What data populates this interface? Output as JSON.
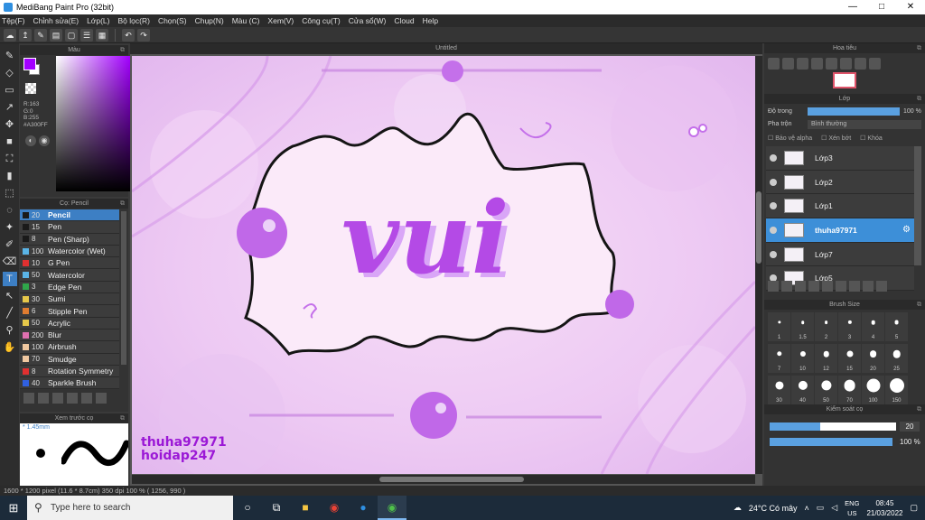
{
  "window": {
    "title": "MediBang Paint Pro (32bit)",
    "min": "—",
    "max": "□",
    "close": "✕"
  },
  "menu": [
    "Tệp(F)",
    "Chỉnh sửa(E)",
    "Lớp(L)",
    "Bộ lọc(R)",
    "Chọn(S)",
    "Chụp(N)",
    "Màu (C)",
    "Xem(V)",
    "Công cụ(T)",
    "Cửa sổ(W)",
    "Cloud",
    "Help"
  ],
  "color_panel": {
    "title": "Màu",
    "r": "R:163",
    "g": "G:0",
    "b": "B:255",
    "hex": "#A300FF",
    "fg_color": "#A300FF"
  },
  "brush_panel": {
    "title": "Cọ: Pencil",
    "brushes": [
      {
        "size": "20",
        "name": "Pencil",
        "color": "#1a1a1a"
      },
      {
        "size": "15",
        "name": "Pen",
        "color": "#1a1a1a"
      },
      {
        "size": "8",
        "name": "Pen (Sharp)",
        "color": "#1a1a1a"
      },
      {
        "size": "100",
        "name": "Watercolor (Wet)",
        "color": "#5ab4e6"
      },
      {
        "size": "10",
        "name": "G Pen",
        "color": "#e03030"
      },
      {
        "size": "50",
        "name": "Watercolor",
        "color": "#5ab4e6"
      },
      {
        "size": "3",
        "name": "Edge Pen",
        "color": "#2fa64a"
      },
      {
        "size": "30",
        "name": "Sumi",
        "color": "#e6c84a"
      },
      {
        "size": "6",
        "name": "Stipple Pen",
        "color": "#e07c30"
      },
      {
        "size": "50",
        "name": "Acrylic",
        "color": "#e6c84a"
      },
      {
        "size": "200",
        "name": "Blur",
        "color": "#e070b0"
      },
      {
        "size": "100",
        "name": "Airbrush",
        "color": "#f0c8a0"
      },
      {
        "size": "70",
        "name": "Smudge",
        "color": "#f0c8a0"
      },
      {
        "size": "8",
        "name": "Rotation Symmetry",
        "color": "#e03030"
      },
      {
        "size": "40",
        "name": "Sparkle Brush",
        "color": "#3060e0"
      }
    ]
  },
  "preview": {
    "title": "Xem trước cọ",
    "size": "1.45mm"
  },
  "canvas": {
    "tab": "Untitled",
    "text": "vui",
    "watermark1": "thuha97971",
    "watermark2": "hoidap247"
  },
  "navigator": {
    "title": "Hoa tiêu"
  },
  "layer_panel": {
    "title": "Lớp",
    "opacity_label": "Độ trong",
    "opacity_value": "100 %",
    "opacity": 1.0,
    "blend_label": "Pha trộn",
    "blend_value": "Bình thường",
    "alpha_label": "Bảo vệ alpha",
    "clip_label": "Xén bớt",
    "lock_label": "Khóa",
    "layers": [
      "Lớp3",
      "Lớp2",
      "Lớp1",
      "thuha97971",
      "Lớp7",
      "Lớp5"
    ]
  },
  "brush_size": {
    "title": "Brush Size",
    "sizes": [
      "1",
      "1.5",
      "2",
      "3",
      "4",
      "5",
      "7",
      "10",
      "12",
      "15",
      "20",
      "25",
      "30",
      "40",
      "50",
      "70",
      "100",
      "150"
    ]
  },
  "control": {
    "title": "Kiểm soát cọ",
    "size_value": "20",
    "size_fraction": 0.4,
    "opacity_value": "100 %"
  },
  "status": {
    "text": "1600 * 1200 pixel   (11.6 * 8.7cm)   350 dpi   100 %   ( 1256, 990 )"
  },
  "taskbar": {
    "search": "Type here to search",
    "weather": "24°C  Có mây",
    "lang1": "ENG",
    "lang2": "US",
    "time": "08:45",
    "date": "21/03/2022"
  }
}
